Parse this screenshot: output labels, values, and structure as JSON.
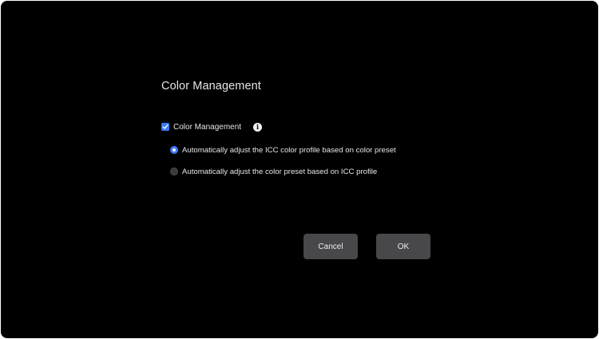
{
  "dialog": {
    "title": "Color Management"
  },
  "color_management": {
    "checkbox_label": "Color Management",
    "checked": true,
    "info_icon": "info-icon"
  },
  "options": [
    {
      "label": "Automatically adjust the ICC color profile based on color preset",
      "selected": true
    },
    {
      "label": "Automatically adjust the color preset based on ICC profile",
      "selected": false
    }
  ],
  "buttons": {
    "cancel_label": "Cancel",
    "ok_label": "OK"
  },
  "colors": {
    "background": "#000000",
    "accent": "#3a7bf5",
    "button": "#48484a",
    "text": "#e6e6e6"
  }
}
